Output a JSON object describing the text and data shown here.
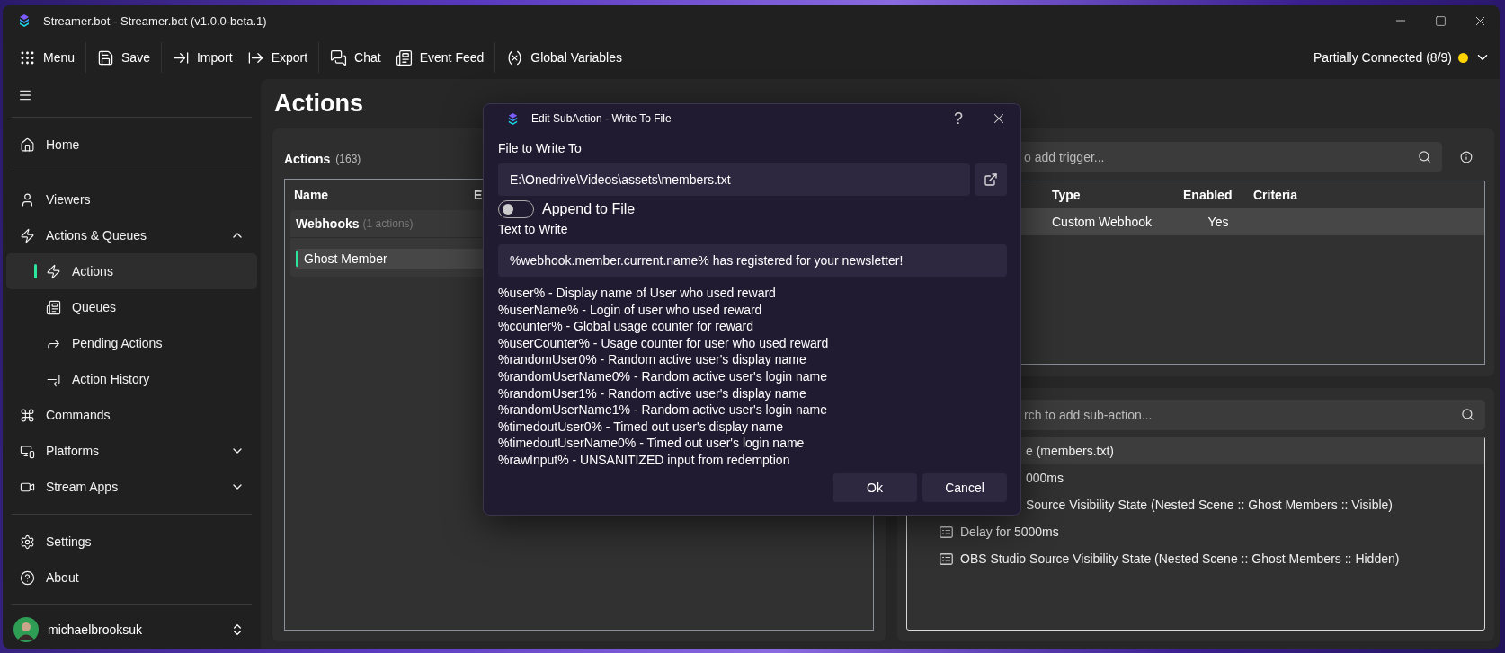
{
  "window": {
    "title": "Streamer.bot - Streamer.bot (v1.0.0-beta.1)"
  },
  "toolbar": {
    "groups": [
      [
        {
          "kind": "menu",
          "label": "Menu"
        }
      ],
      [
        {
          "kind": "save",
          "label": "Save"
        }
      ],
      [
        {
          "kind": "import",
          "label": "Import"
        },
        {
          "kind": "export",
          "label": "Export"
        }
      ],
      [
        {
          "kind": "chat",
          "label": "Chat"
        },
        {
          "kind": "event-feed",
          "label": "Event Feed"
        }
      ],
      [
        {
          "kind": "variables",
          "label": "Global Variables"
        }
      ]
    ]
  },
  "connection": {
    "label": "Partially Connected (8/9)",
    "color": "#ffd400"
  },
  "sidebar": {
    "sections": [
      [
        {
          "kind": "home",
          "label": "Home",
          "selected": false
        }
      ],
      [
        {
          "kind": "viewers",
          "label": "Viewers",
          "selected": false
        },
        {
          "kind": "actions",
          "label": "Actions & Queues",
          "selected": false,
          "expanded": true,
          "children": [
            {
              "kind": "actions",
              "label": "Actions",
              "selected": true
            },
            {
              "kind": "queues",
              "label": "Queues",
              "selected": false
            },
            {
              "kind": "pending",
              "label": "Pending Actions",
              "selected": false
            },
            {
              "kind": "history",
              "label": "Action History",
              "selected": false
            }
          ]
        },
        {
          "kind": "commands",
          "label": "Commands",
          "selected": false
        },
        {
          "kind": "platforms",
          "label": "Platforms",
          "selected": false,
          "expanded": false
        },
        {
          "kind": "stream-apps",
          "label": "Stream Apps",
          "selected": false,
          "expanded": false
        }
      ],
      [
        {
          "kind": "settings",
          "label": "Settings",
          "selected": false
        },
        {
          "kind": "about",
          "label": "About",
          "selected": false
        }
      ]
    ],
    "user": {
      "name": "michaelbrooksuk"
    }
  },
  "page_title": "Actions",
  "actions_panel": {
    "title": "Actions",
    "count": "(163)",
    "columns": [
      "Name",
      "E"
    ],
    "groups": [
      {
        "name": "Webhooks",
        "count": "(1 actions)",
        "actions": [
          {
            "name": "Ghost Member",
            "enabled": true,
            "selected": true
          }
        ]
      }
    ]
  },
  "triggers_panel": {
    "search_placeholder": "o add trigger...",
    "columns": [
      "Type",
      "Enabled",
      "Criteria"
    ],
    "rows": [
      {
        "type": "Custom Webhook",
        "enabled": "Yes",
        "selected": true
      }
    ]
  },
  "subactions_panel": {
    "search_placeholder": "rch to add sub-action...",
    "items": [
      {
        "kind": "partial",
        "label": "e (members.txt)",
        "selected": true
      },
      {
        "kind": "partial",
        "label": "000ms",
        "selected": false
      },
      {
        "kind": "partial",
        "label": "Source Visibility State (Nested Scene :: Ghost Members :: Visible)",
        "selected": false
      },
      {
        "kind": "full",
        "label": "Delay for 5000ms",
        "selected": false
      },
      {
        "kind": "full",
        "label": "OBS Studio Source Visibility State (Nested Scene :: Ghost Members :: Hidden)",
        "selected": false
      }
    ]
  },
  "dialog": {
    "title": "Edit SubAction - Write To File",
    "help_button": "?",
    "file_label": "File to Write To",
    "file_value": "E:\\Onedrive\\Videos\\assets\\members.txt",
    "append": {
      "label": "Append to File",
      "on": false
    },
    "text_label": "Text to Write",
    "text_value": "%webhook.member.current.name% has registered for your newsletter!",
    "help_lines": [
      "%user% - Display name of User who used reward",
      "%userName% - Login of user who used reward",
      "%counter% - Global usage counter for reward",
      "%userCounter% - Usage counter for user who used reward",
      "%randomUser0% - Random active user's display name",
      "%randomUserName0% - Random active user's login name",
      "%randomUser1% - Random active user's display name",
      "%randomUserName1% - Random active user's login name",
      "%timedoutUser0% - Timed out user's display name",
      "%timedoutUserName0% - Timed out user's login name",
      "%rawInput% - UNSANITIZED input from redemption"
    ],
    "buttons": [
      "Ok",
      "Cancel"
    ]
  }
}
